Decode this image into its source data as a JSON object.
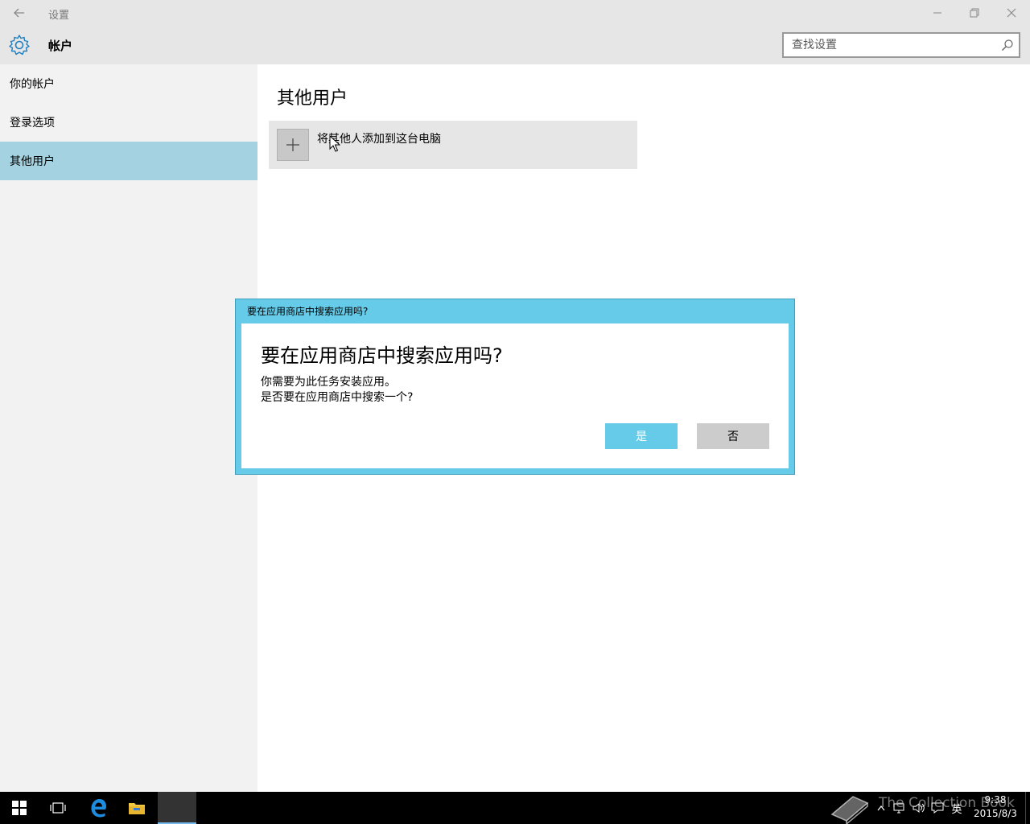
{
  "window": {
    "back_icon": "back-arrow-icon",
    "title": "设置",
    "controls": [
      "minimize-icon",
      "restore-icon",
      "close-icon"
    ]
  },
  "header": {
    "section_title": "帐户",
    "icon": "gear-icon",
    "search_placeholder": "查找设置",
    "accent": "#1e7fc0"
  },
  "sidebar": {
    "items": [
      {
        "label": "你的帐户",
        "active": false
      },
      {
        "label": "登录选项",
        "active": false
      },
      {
        "label": "其他用户",
        "active": true
      }
    ],
    "active_color": "#a4d2e0"
  },
  "main": {
    "title": "其他用户",
    "add_user_label": "将其他人添加到这台电脑",
    "add_icon": "plus-icon"
  },
  "dialog": {
    "window_title": "要在应用商店中搜索应用吗?",
    "heading": "要在应用商店中搜索应用吗?",
    "message_line1": "你需要为此任务安装应用。",
    "message_line2": "是否要在应用商店中搜索一个?",
    "yes_label": "是",
    "no_label": "否",
    "accent": "#66cbe8"
  },
  "taskbar": {
    "icons": [
      "windows-start-icon",
      "task-view-icon",
      "edge-icon",
      "file-explorer-icon",
      "active-app"
    ],
    "tray_icons": [
      "chevron-up-icon",
      "network-icon",
      "volume-icon",
      "notification-icon"
    ],
    "ime_label": "英",
    "time": "9:38",
    "date": "2015/8/3"
  },
  "watermark": {
    "text": "The Collection Book"
  }
}
